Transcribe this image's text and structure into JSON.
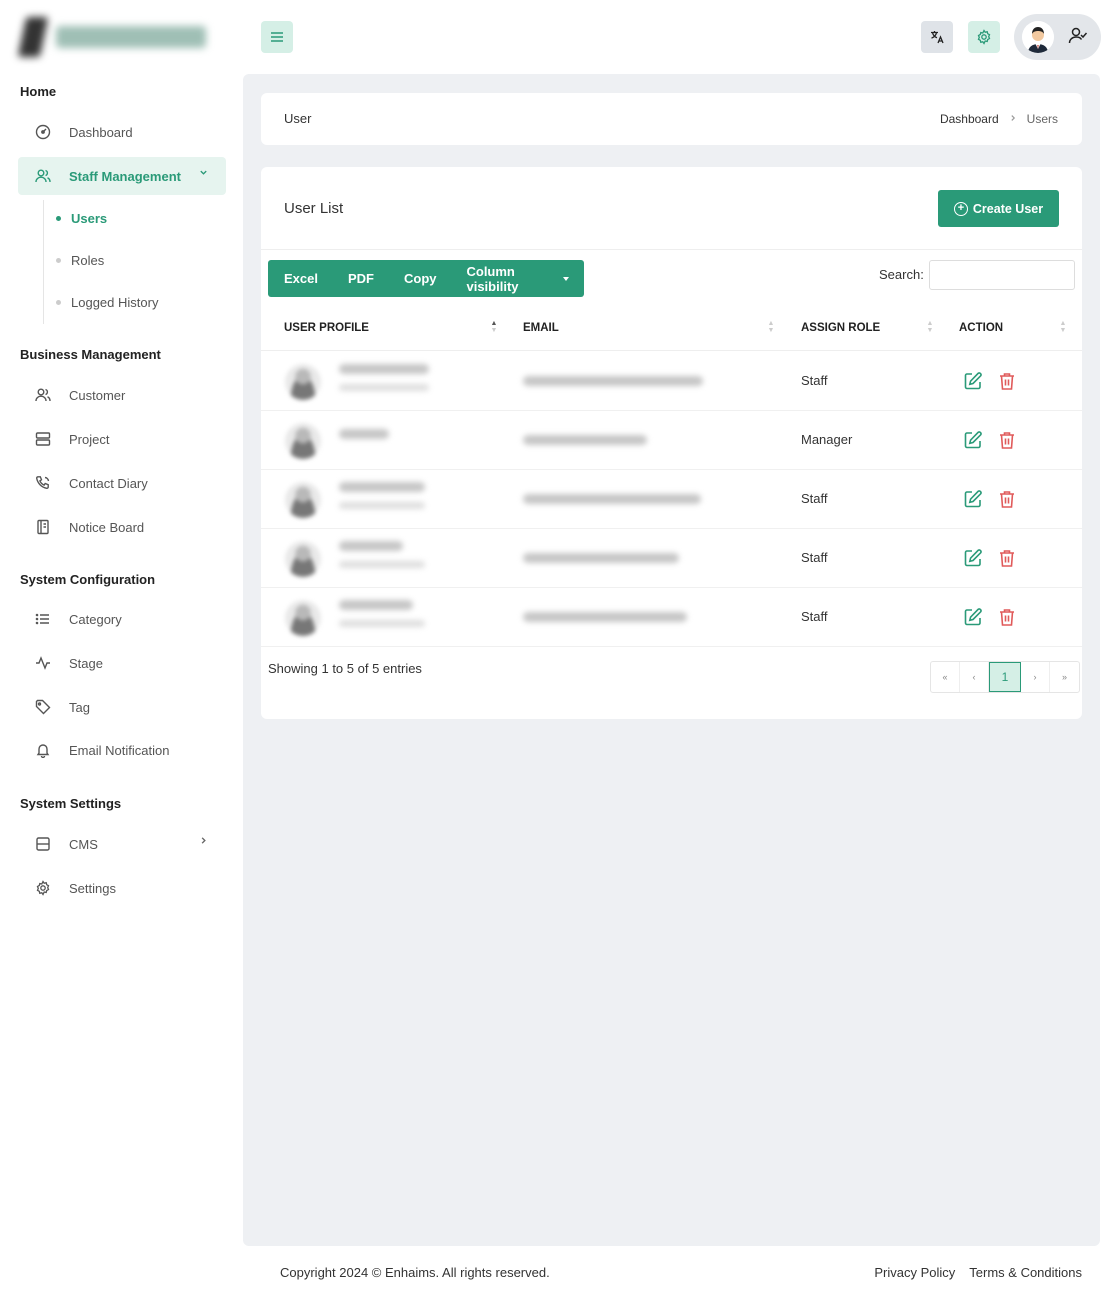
{
  "sidebar": {
    "sections": {
      "home": "Home",
      "business": "Business Management",
      "system_config": "System Configuration",
      "system_settings": "System Settings"
    },
    "items": {
      "dashboard": "Dashboard",
      "staff_management": "Staff Management",
      "customer": "Customer",
      "project": "Project",
      "contact_diary": "Contact Diary",
      "notice_board": "Notice Board",
      "category": "Category",
      "stage": "Stage",
      "tag": "Tag",
      "email_notification": "Email Notification",
      "cms": "CMS",
      "settings": "Settings"
    },
    "submenu": {
      "users": "Users",
      "roles": "Roles",
      "logged_history": "Logged History"
    }
  },
  "breadcrumb_card": {
    "title": "User",
    "crumbs": [
      "Dashboard",
      "Users"
    ]
  },
  "user_list": {
    "title": "User List",
    "create_label": "Create User",
    "export_buttons": [
      "Excel",
      "PDF",
      "Copy",
      "Column visibility"
    ],
    "search_label": "Search:",
    "search_value": "",
    "columns": [
      "USER PROFILE",
      "EMAIL",
      "ASSIGN ROLE",
      "ACTION"
    ],
    "rows": [
      {
        "role": "Staff"
      },
      {
        "role": "Manager"
      },
      {
        "role": "Staff"
      },
      {
        "role": "Staff"
      },
      {
        "role": "Staff"
      }
    ],
    "showing": "Showing 1 to 5 of 5 entries",
    "pagination": [
      "«",
      "‹",
      "1",
      "›",
      "»"
    ]
  },
  "footer": {
    "copyright": "Copyright 2024 © Enhaims. All rights reserved.",
    "links": [
      "Privacy Policy",
      "Terms & Conditions"
    ]
  },
  "colors": {
    "accent": "#2a9a78",
    "accent_light": "#d5efe6",
    "danger": "#e05a5a",
    "main_bg": "#eef0f3"
  }
}
